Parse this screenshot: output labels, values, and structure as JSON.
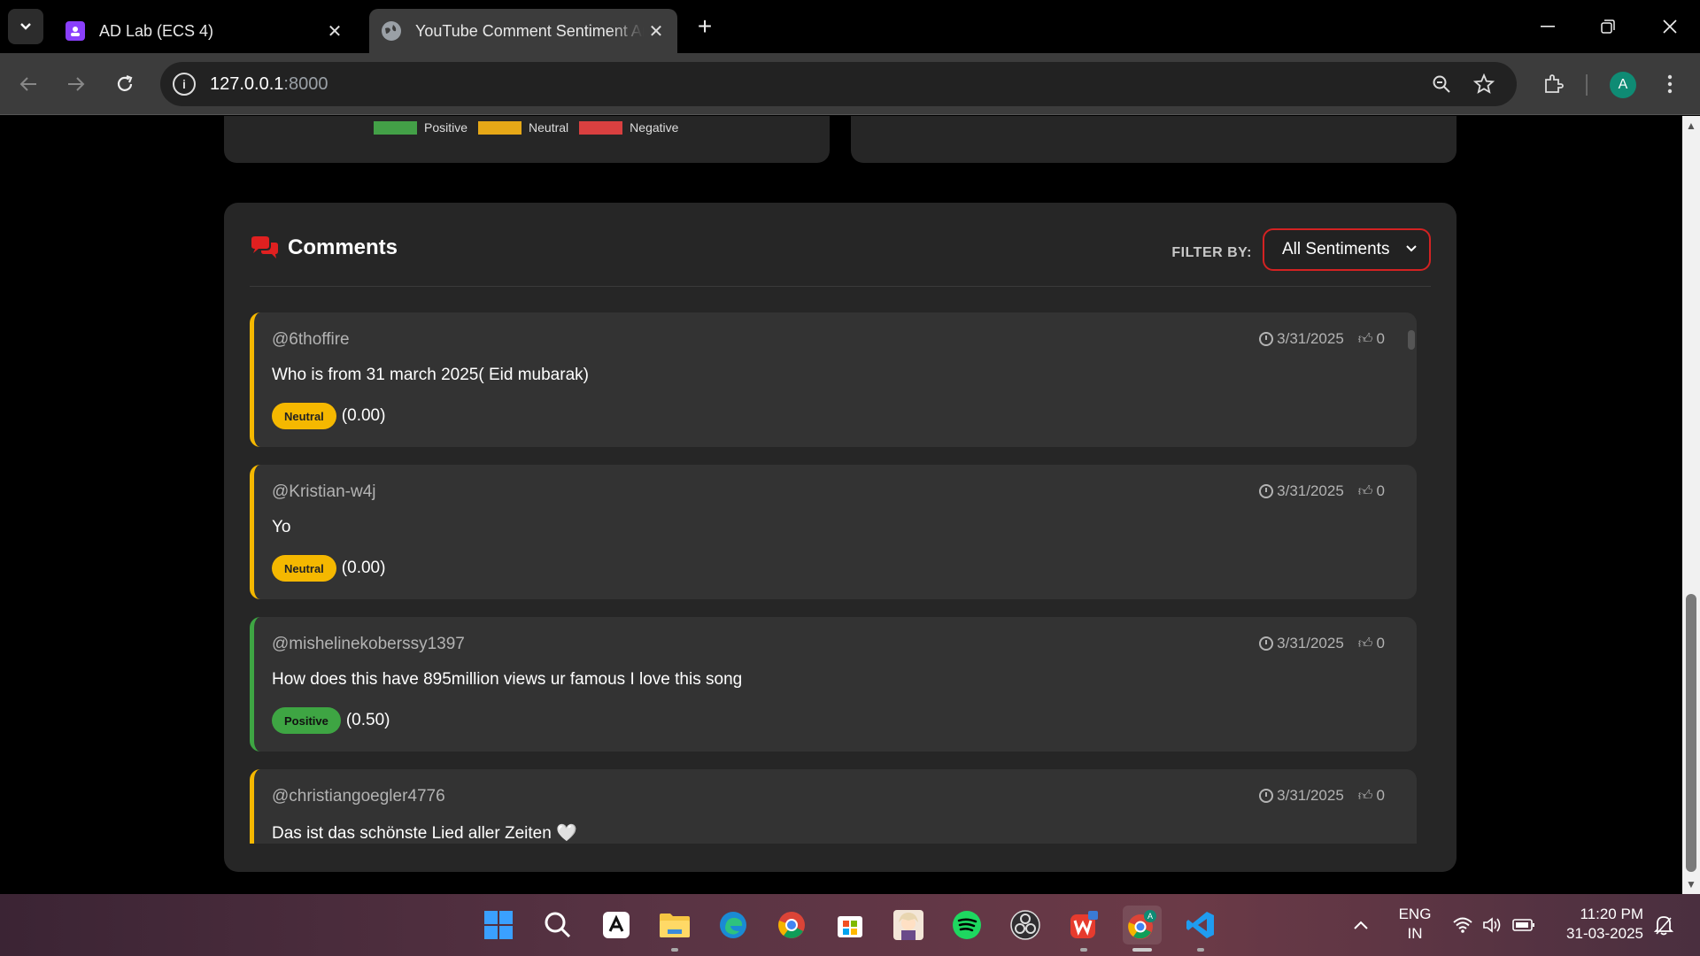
{
  "browser": {
    "tabs": [
      {
        "title": "AD Lab (ECS 4)",
        "active": false
      },
      {
        "title": "YouTube Comment Sentiment Analysis",
        "active": true
      }
    ],
    "url_host": "127.0.0.1",
    "url_port": ":8000",
    "profile_initial": "A"
  },
  "legend": {
    "items": [
      {
        "label": "Positive",
        "color": "#43a047"
      },
      {
        "label": "Neutral",
        "color": "#e6a817"
      },
      {
        "label": "Negative",
        "color": "#d94040"
      }
    ]
  },
  "comments_section": {
    "title": "Comments",
    "filter_label": "FILTER BY:",
    "filter_value": "All Sentiments",
    "items": [
      {
        "author": "@6thoffire",
        "date": "3/31/2025",
        "likes": "0",
        "text": "Who is from 31 march 2025( Eid mubarak)",
        "sentiment": "Neutral",
        "score": "(0.00)"
      },
      {
        "author": "@Kristian-w4j",
        "date": "3/31/2025",
        "likes": "0",
        "text": "Yo",
        "sentiment": "Neutral",
        "score": "(0.00)"
      },
      {
        "author": "@mishelinekoberssy1397",
        "date": "3/31/2025",
        "likes": "0",
        "text": "How does this have 895million views ur famous I love this song",
        "sentiment": "Positive",
        "score": "(0.50)"
      },
      {
        "author": "@christiangoegler4776",
        "date": "3/31/2025",
        "likes": "0",
        "text": "Das ist das schönste Lied aller Zeiten 🤍",
        "sentiment": "",
        "score": ""
      }
    ]
  },
  "taskbar": {
    "lang_line1": "ENG",
    "lang_line2": "IN",
    "time": "11:20 PM",
    "date": "31-03-2025"
  }
}
